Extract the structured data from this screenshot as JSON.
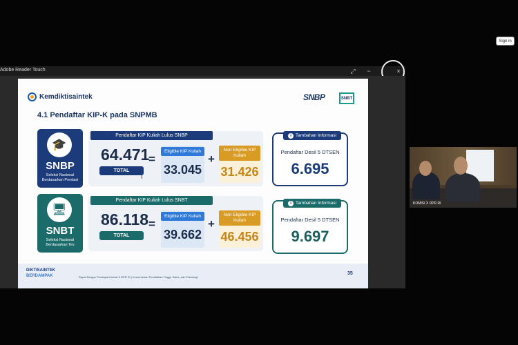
{
  "top": {
    "signin_label": "Sign in"
  },
  "reader": {
    "title": "Adobe Reader Touch",
    "expand_icon": "⤢",
    "minimize_icon": "−",
    "close_icon": "×"
  },
  "slide": {
    "brand": "Kemdiktisaintek",
    "logo_snbp": "SNBP",
    "logo_snbt": "SNBT",
    "section_title": "4.1 Pendaftar KIP-K pada SNPMB",
    "snbp": {
      "name": "SNBP",
      "subtitle": "Seleksi Nasional Berdasarkan Prestasi",
      "header": "Pendaftar KIP Kuliah Lulus SNBP",
      "total": "64.471",
      "total_label": "TOTAL",
      "eligible_label": "Eligible KIP Kuliah",
      "eligible": "33.045",
      "non_eligible_label": "Non Eligible KIP Kuliah",
      "non_eligible": "31.426",
      "info_label": "Tambahan Informasi",
      "info_text": "Pendaftar Desil 5 DTSEN",
      "info_value": "6.695"
    },
    "snbt": {
      "name": "SNBT",
      "subtitle": "Seleksi Nasional Berdasarkan Tes",
      "header": "Pendaftar KIP Kuliah Lulus SNBT",
      "total": "86.118",
      "total_label": "TOTAL",
      "eligible_label": "Eligible KIP Kuliah",
      "eligible": "39.662",
      "non_eligible_label": "Non Eligible KIP Kuliah",
      "non_eligible": "46.456",
      "info_label": "Tambahan Informasi",
      "info_text": "Pendaftar Desil 5 DTSEN",
      "info_value": "9.697"
    },
    "equals": "=",
    "plus": "+",
    "footer_logo_1": "DIKTISAINTEK",
    "footer_logo_2": "BERDAMPAK",
    "footer_text": "Rapat Dengar Pendapat Komisi X DPR RI  |  Kementerian Pendidikan Tinggi, Sains, dan Teknologi",
    "page_number": "35"
  },
  "video": {
    "label": "KOMISI X DPR RI"
  }
}
